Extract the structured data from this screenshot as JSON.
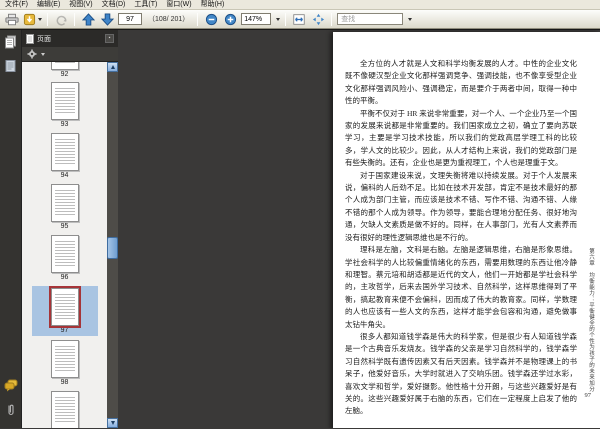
{
  "menu": {
    "items": [
      "文件(F)",
      "编辑(E)",
      "视图(V)",
      "文档(D)",
      "工具(T)",
      "窗口(W)",
      "帮助(H)"
    ]
  },
  "toolbar": {
    "current_page": "97",
    "page_indicator": "（108/ 201）",
    "zoom_level": "147%",
    "search_placeholder": "查找"
  },
  "sidebar": {
    "panel_title": "页面",
    "thumbnails": [
      "92",
      "93",
      "94",
      "95",
      "96",
      "97",
      "98",
      ""
    ],
    "selected_page": "97"
  },
  "document": {
    "paragraphs": [
      "全方位的人才就是人文和科学均衡发展的人才。中性的企业文化既不像硬汉型企业文化那样强调竞争、强调技能，也不像享受型企业文化那样强调风险小、强调稳定，而是要介于两者中间，取得一种中性的平衡。",
      "平衡不仅对于 HR 来说非常重要，对一个人、一个企业乃至一个国家的发展来说都是非常重要的。我们国家成立之初，确立了要向苏联学习，主要是学习技术技能，所以我们的党政高层学理工科的比较多，学人文的比较少。因此，从人才结构上来说，我们的党政部门是有些失衡的。还有，企业也是更为重视理工，个人也是理重于文。",
      "对于国家建设来说，文理失衡将难以持续发展。对于个人发展来说，偏科的人后劲不足。比如在技术开发部，肯定不是技术最好的那个人成为部门主管，而应该是技术不错、写作不错、沟通不错、人缘不错的那个人成为领导。作为领导，要能合理地分配任务、很好地沟通，欠缺人文素质是做不好的。同样，在人事部门，光有人文素养而没有很好的理性逻辑思维也是不行的。",
      "理科是左脑，文科是右脑。左脑是逻辑思维，右脑是形象思维。学社会科学的人比较偏重情绪化的东西，需要用数理的东西让他冷静和理智。蔡元培和胡适都是近代的文人，他们一开始都是学社会科学的，主攻哲学，后来去国外学习技术、自然科学，这样思维得到了平衡，搞起教育来便不会偏科，因而成了伟大的教育家。同样，学数理的人也应该有一些人文的东西，这样才能学会包容和沟通，避免做事太钻牛角尖。",
      "很多人都知道钱学森是伟大的科学家，但是很少有人知道钱学森是一个古典音乐发烧友。钱学森的父亲是学习自然科学的，钱学森学习自然科学既有遗传因素又有后天因素。钱学森并不是物理课上的书呆子，他爱好音乐，大学时就进入了交响乐团。钱学森还学过水彩，喜欢文学和哲学，爱好摄影。他性格十分开朗，与这些兴趣爱好是有关的。这些兴趣爱好属于右脑的东西，它们在一定程度上启发了他的左脑。"
    ],
    "side_caption": "第六章　均衡能力：平衡健全的个性为孩子的未来加分",
    "page_number": "97"
  },
  "colors": {
    "accent_blue": "#2e6eb5",
    "selection_red": "#a63438",
    "selection_blue": "#a9c4e2",
    "panel_dark": "#343330",
    "toolbar_bg": "#e8e5d8"
  }
}
